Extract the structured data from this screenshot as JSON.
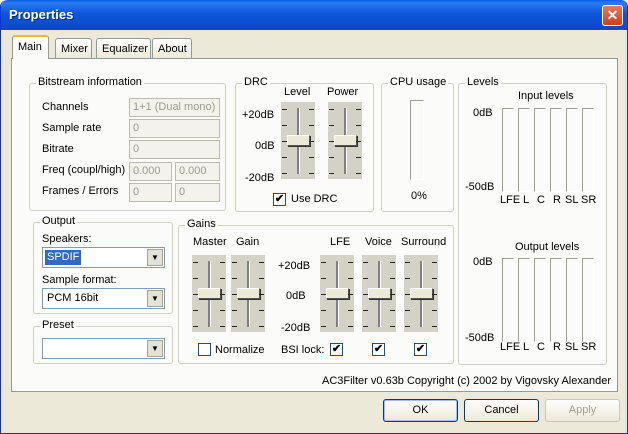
{
  "window": {
    "title": "Properties"
  },
  "tabs": [
    {
      "label": "Main"
    },
    {
      "label": "Mixer"
    },
    {
      "label": "Equalizer"
    },
    {
      "label": "About"
    }
  ],
  "bitstream": {
    "label": "Bitstream information",
    "channels_label": "Channels",
    "channels_value": "1+1 (Dual mono)",
    "sample_rate_label": "Sample rate",
    "sample_rate_value": "0",
    "bitrate_label": "Bitrate",
    "bitrate_value": "0",
    "freq_label": "Freq (coupl/high)",
    "freq_coupl_value": "0.000",
    "freq_high_value": "0.000",
    "frames_label": "Frames / Errors",
    "frames_value": "0",
    "errors_value": "0"
  },
  "drc": {
    "label": "DRC",
    "level_label": "Level",
    "power_label": "Power",
    "plus_label": "+20dB",
    "zero_label": "0dB",
    "minus_label": "-20dB",
    "use_drc_label": "Use DRC",
    "use_drc_checked": true,
    "level_value": 0,
    "power_value": 0,
    "check_glyph": "✔"
  },
  "cpu": {
    "label": "CPU usage",
    "value": "0%"
  },
  "levels": {
    "label": "Levels",
    "input_title": "Input levels",
    "output_title": "Output levels",
    "top_label": "0dB",
    "bottom_label": "-50dB",
    "channels": [
      "LFE",
      "L",
      "C",
      "R",
      "SL",
      "SR"
    ]
  },
  "output": {
    "label": "Output",
    "speakers_label": "Speakers:",
    "speakers_value": "SPDIF",
    "format_label": "Sample format:",
    "format_value": "PCM 16bit",
    "dropdown_glyph": "▼"
  },
  "preset": {
    "label": "Preset",
    "value": "",
    "dropdown_glyph": "▼"
  },
  "gains": {
    "label": "Gains",
    "master_label": "Master",
    "gain_label": "Gain",
    "lfe_label": "LFE",
    "voice_label": "Voice",
    "surround_label": "Surround",
    "plus_label": "+20dB",
    "zero_label": "0dB",
    "minus_label": "-20dB",
    "normalize_label": "Normalize",
    "normalize_checked": false,
    "bsi_lock_label": "BSI lock:",
    "check_glyph": "✔",
    "master_value": 0,
    "gain_value": 0,
    "lfe_value": 0,
    "voice_value": 0,
    "surround_value": 0
  },
  "copyright": "AC3Filter v0.63b Copyright (c) 2002 by Vigovsky Alexander",
  "buttons": {
    "ok": "OK",
    "cancel": "Cancel",
    "apply": "Apply",
    "close_glyph": "✕"
  },
  "colors": {
    "titlebar": "#0b4fcf",
    "accent_tab": "#f2b83a",
    "selection": "#316ac5",
    "face": "#ece9d8"
  }
}
